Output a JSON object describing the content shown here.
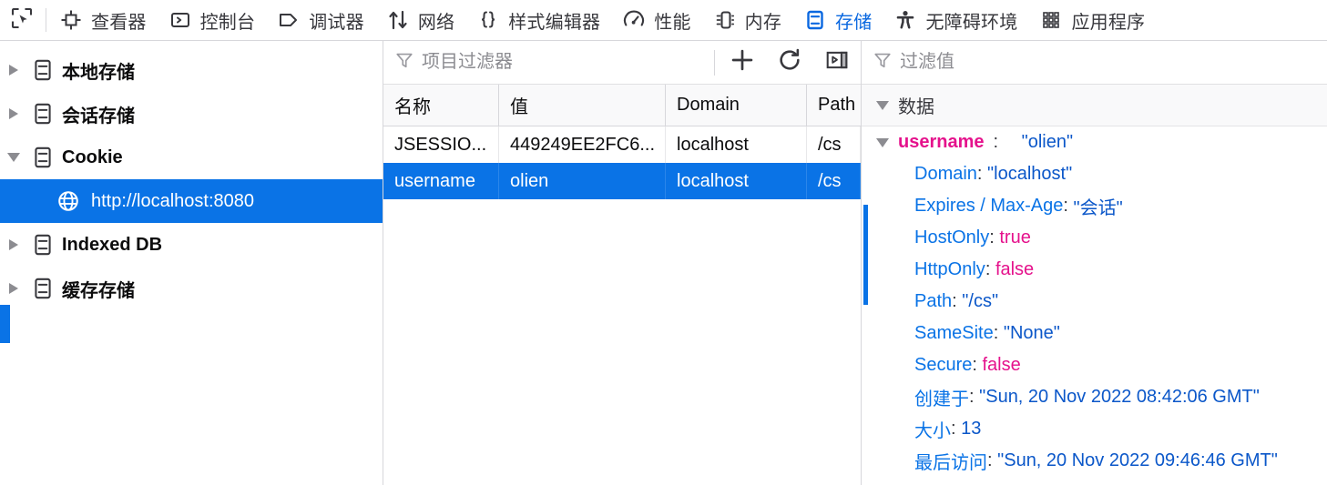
{
  "toolbar": {
    "picker_icon": "node-picker-icon",
    "tabs": [
      {
        "label": "查看器",
        "icon": "inspector-icon",
        "selected": false
      },
      {
        "label": "控制台",
        "icon": "console-icon",
        "selected": false
      },
      {
        "label": "调试器",
        "icon": "debugger-icon",
        "selected": false
      },
      {
        "label": "网络",
        "icon": "network-icon",
        "selected": false
      },
      {
        "label": "样式编辑器",
        "icon": "style-editor-icon",
        "selected": false
      },
      {
        "label": "性能",
        "icon": "performance-icon",
        "selected": false
      },
      {
        "label": "内存",
        "icon": "memory-icon",
        "selected": false
      },
      {
        "label": "存储",
        "icon": "storage-icon",
        "selected": true
      },
      {
        "label": "无障碍环境",
        "icon": "accessibility-icon",
        "selected": false
      },
      {
        "label": "应用程序",
        "icon": "application-icon",
        "selected": false
      }
    ],
    "selected_tab_color": "#0a68e0"
  },
  "sidebar": {
    "items": [
      {
        "label": "本地存储",
        "icon": "storage-item-icon",
        "expanded": false,
        "selected": false,
        "level": 0
      },
      {
        "label": "会话存储",
        "icon": "storage-item-icon",
        "expanded": false,
        "selected": false,
        "level": 0
      },
      {
        "label": "Cookie",
        "icon": "storage-item-icon",
        "expanded": true,
        "selected": false,
        "level": 0
      },
      {
        "label": "http://localhost:8080",
        "icon": "globe-icon",
        "expanded": null,
        "selected": true,
        "level": 1
      },
      {
        "label": "Indexed DB",
        "icon": "storage-item-icon",
        "expanded": false,
        "selected": false,
        "level": 0
      },
      {
        "label": "缓存存储",
        "icon": "storage-item-icon",
        "expanded": false,
        "selected": false,
        "level": 0
      }
    ],
    "selection_color": "#0a73e6"
  },
  "table": {
    "filter": {
      "placeholder": "项目过滤器",
      "value": "",
      "icon": "filter-funnel-icon"
    },
    "actions": [
      {
        "name": "add-item-button",
        "icon": "plus-icon"
      },
      {
        "name": "refresh-button",
        "icon": "refresh-icon"
      },
      {
        "name": "toggle-sidebar-button",
        "icon": "panel-toggle-icon"
      }
    ],
    "columns": [
      "名称",
      "值",
      "Domain",
      "Path"
    ],
    "rows": [
      {
        "name": "JSESSIO...",
        "value": "449249EE2FC6...",
        "domain": "localhost",
        "path": "/cs",
        "selected": false
      },
      {
        "name": "username",
        "value": "olien",
        "domain": "localhost",
        "path": "/cs",
        "selected": true
      }
    ]
  },
  "detail": {
    "filter": {
      "placeholder": "过滤值",
      "value": "",
      "icon": "filter-funnel-icon"
    },
    "group_label": "数据",
    "root": {
      "key": "username",
      "colon": ":",
      "value": "\"olien\""
    },
    "properties": [
      {
        "key": "Domain",
        "colon": ":",
        "value": "\"localhost\"",
        "kind": "string"
      },
      {
        "key": "Expires / Max-Age",
        "colon": ":",
        "value": "\"会话\"",
        "kind": "string"
      },
      {
        "key": "HostOnly",
        "colon": ":",
        "value": "true",
        "kind": "bool"
      },
      {
        "key": "HttpOnly",
        "colon": ":",
        "value": "false",
        "kind": "bool"
      },
      {
        "key": "Path",
        "colon": ":",
        "value": "\"/cs\"",
        "kind": "string"
      },
      {
        "key": "SameSite",
        "colon": ":",
        "value": "\"None\"",
        "kind": "string"
      },
      {
        "key": "Secure",
        "colon": ":",
        "value": "false",
        "kind": "bool"
      },
      {
        "key": "创建于",
        "colon": ":",
        "value": "\"Sun, 20 Nov 2022 08:42:06 GMT\"",
        "kind": "string"
      },
      {
        "key": "大小",
        "colon": ":",
        "value": "13",
        "kind": "number"
      },
      {
        "key": "最后访问",
        "colon": ":",
        "value": "\"Sun, 20 Nov 2022 09:46:46 GMT\"",
        "kind": "string"
      }
    ],
    "colors": {
      "key": "#0a73e6",
      "root_key": "#e5128c",
      "string": "#0b57c9",
      "bool": "#e5128c"
    }
  }
}
